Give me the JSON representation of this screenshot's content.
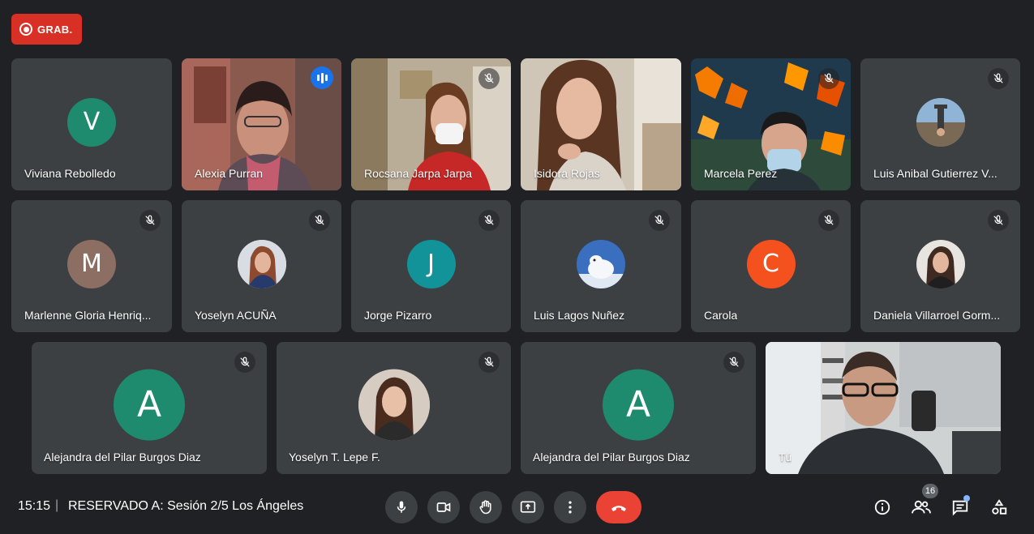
{
  "recording": {
    "label": "GRAB."
  },
  "participants": [
    {
      "name": "Viviana Rebolledo",
      "initial": "V",
      "color": "#1e8a6e",
      "type": "initial",
      "muted": false
    },
    {
      "name": "Alexia Purran",
      "type": "video",
      "speaking": true
    },
    {
      "name": "Rocsana Jarpa Jarpa",
      "type": "video",
      "muted": true
    },
    {
      "name": "Isidora Rojas",
      "type": "video",
      "muted": false
    },
    {
      "name": "Marcela Perez",
      "type": "video",
      "muted": true
    },
    {
      "name": "Luis Anibal Gutierrez V...",
      "type": "photo",
      "muted": true
    },
    {
      "name": "Marlenne Gloria Henriq...",
      "initial": "M",
      "color": "#8d6e63",
      "type": "initial",
      "muted": true
    },
    {
      "name": "Yoselyn ACUÑA",
      "type": "photo",
      "muted": true
    },
    {
      "name": "Jorge Pizarro",
      "initial": "J",
      "color": "#12939a",
      "type": "initial",
      "muted": true
    },
    {
      "name": "Luis Lagos Nuñez",
      "type": "photo",
      "muted": true
    },
    {
      "name": "Carola",
      "initial": "C",
      "color": "#f4511e",
      "type": "initial",
      "muted": true
    },
    {
      "name": "Daniela Villarroel Gorm...",
      "type": "photo",
      "muted": true
    },
    {
      "name": "Alejandra del Pilar Burgos Diaz",
      "initial": "A",
      "color": "#1e8a6e",
      "type": "initial",
      "muted": true
    },
    {
      "name": "Yoselyn T. Lepe F.",
      "type": "photo",
      "muted": true
    },
    {
      "name": "Alejandra del Pilar Burgos Diaz",
      "initial": "A",
      "color": "#1e8a6e",
      "type": "initial",
      "muted": true
    },
    {
      "name": "Tú",
      "type": "video",
      "muted": false
    }
  ],
  "footer": {
    "time": "15:15",
    "separator": "|",
    "meeting_title": "RESERVADO A: Sesión 2/5 Los Ángeles",
    "participant_count": "16"
  },
  "icons": {
    "mic": "mic-icon",
    "camera": "camera-icon",
    "hand": "raise-hand-icon",
    "present": "present-screen-icon",
    "more": "more-options-icon",
    "hangup": "hang-up-icon",
    "info": "info-icon",
    "people": "people-icon",
    "chat": "chat-icon",
    "activities": "activities-icon"
  },
  "colors": {
    "background": "#202124",
    "tile": "#3c4043",
    "record": "#d93025",
    "hangup": "#ea4335",
    "active_speaker": "#8ab4f8"
  }
}
